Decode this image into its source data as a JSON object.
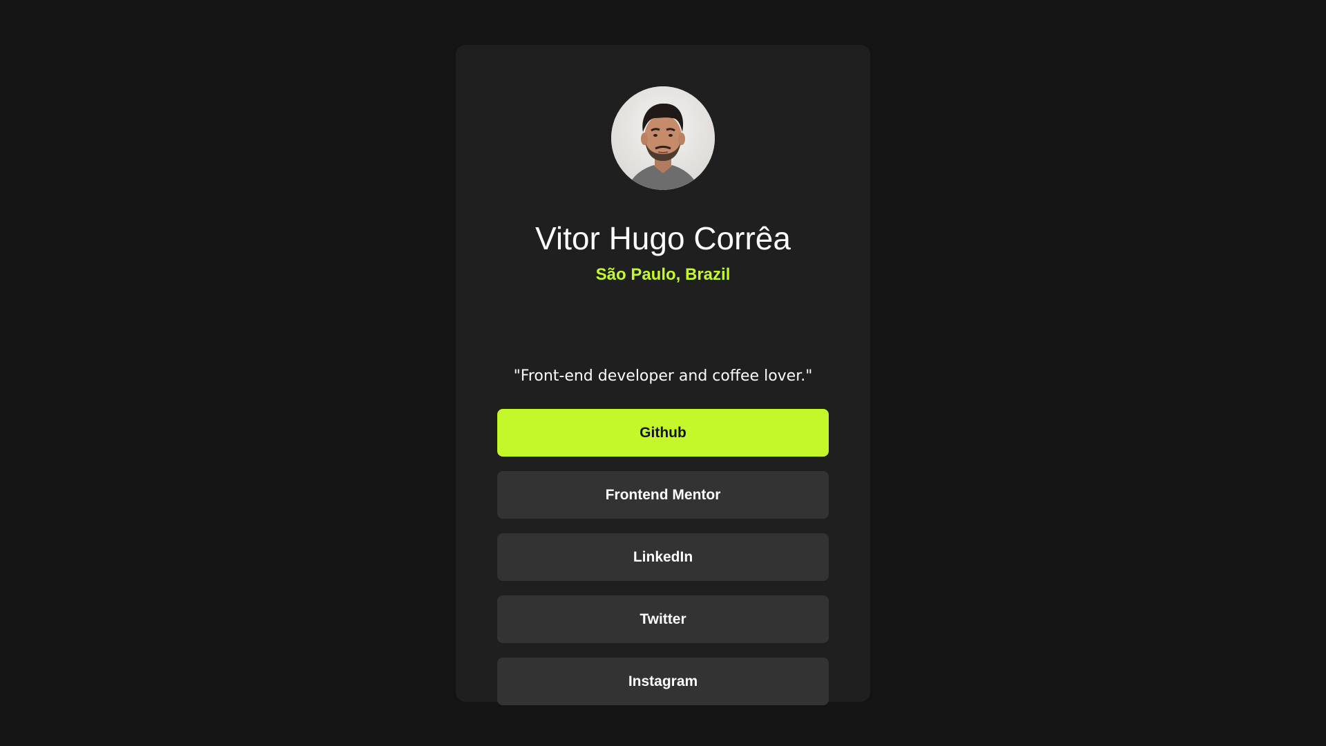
{
  "profile": {
    "name": "Vitor Hugo Corrêa",
    "location": "São Paulo, Brazil",
    "bio": "\"Front-end developer and coffee lover.\"",
    "avatar_icon": "profile-photo"
  },
  "links": [
    {
      "label": "Github",
      "active": true
    },
    {
      "label": "Frontend Mentor",
      "active": false
    },
    {
      "label": "LinkedIn",
      "active": false
    },
    {
      "label": "Twitter",
      "active": false
    },
    {
      "label": "Instagram",
      "active": false
    }
  ],
  "colors": {
    "background": "#141414",
    "card": "#1f1f1f",
    "accent": "#c4f82a",
    "button": "#333333",
    "text": "#ffffff"
  }
}
